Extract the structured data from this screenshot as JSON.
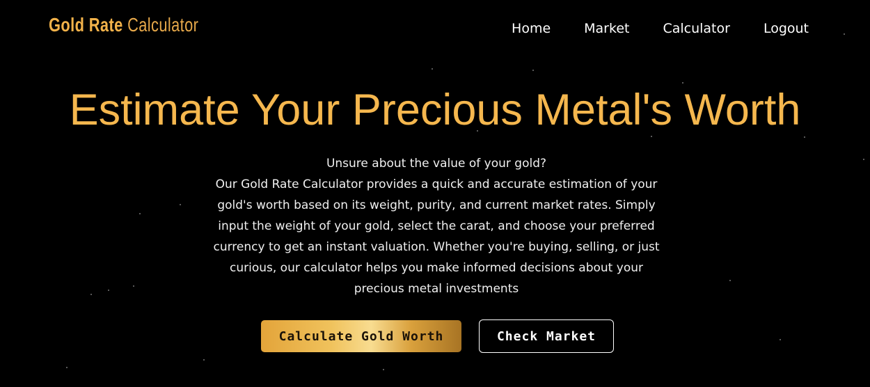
{
  "brand": {
    "bold": "Gold Rate",
    "light": "Calculator"
  },
  "nav": {
    "items": [
      {
        "label": "Home"
      },
      {
        "label": "Market"
      },
      {
        "label": "Calculator"
      },
      {
        "label": "Logout"
      }
    ]
  },
  "hero": {
    "title": "Estimate Your Precious Metal's Worth",
    "lead": "Unsure about the value of your gold?",
    "description": "Our Gold Rate Calculator provides a quick and accurate estimation of your gold's worth based on its weight, purity, and current market rates. Simply input the weight of your gold, select the carat, and choose your preferred currency to get an instant valuation. Whether you're buying, selling, or just curious, our calculator helps you make informed decisions about your precious metal investments"
  },
  "actions": {
    "primary_label": "Calculate Gold Worth",
    "secondary_label": "Check Market"
  },
  "colors": {
    "background": "#000000",
    "accent": "#f5b74e",
    "text": "#ffffff"
  }
}
